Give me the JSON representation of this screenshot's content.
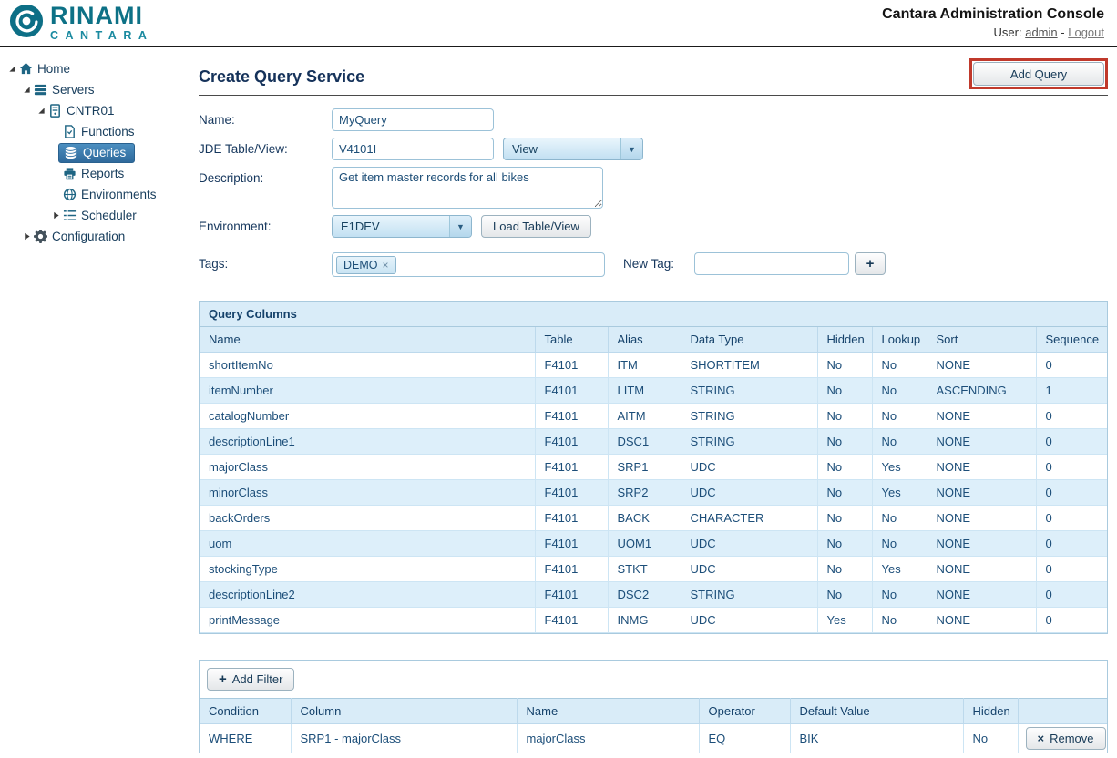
{
  "icons": {
    "close": "×",
    "plus": "+",
    "dropdown_arrow": "▼"
  },
  "header": {
    "brand": "RINAMI",
    "sub_brand": "CANTARA",
    "app_title": "Cantara Administration Console",
    "user_label": "User:",
    "user_name": "admin",
    "separator": "-",
    "logout_label": "Logout"
  },
  "sidebar": {
    "items": [
      {
        "label": "Home",
        "selected": false
      },
      {
        "label": "Servers",
        "selected": false
      },
      {
        "label": "CNTR01",
        "selected": false
      },
      {
        "label": "Functions",
        "selected": false
      },
      {
        "label": "Queries",
        "selected": true
      },
      {
        "label": "Reports",
        "selected": false
      },
      {
        "label": "Environments",
        "selected": false
      },
      {
        "label": "Scheduler",
        "selected": false
      },
      {
        "label": "Configuration",
        "selected": false
      }
    ]
  },
  "main": {
    "title": "Create Query Service",
    "add_query_label": "Add Query"
  },
  "form": {
    "name": {
      "label": "Name:",
      "value": "MyQuery"
    },
    "jde_table_view": {
      "label": "JDE Table/View:",
      "value": "V4101I",
      "type_selected": "View"
    },
    "description": {
      "label": "Description:",
      "value": "Get item master records for all bikes"
    },
    "environment": {
      "label": "Environment:",
      "selected": "E1DEV",
      "load_button_label": "Load Table/View"
    },
    "tags": {
      "label": "Tags:",
      "values": [
        "DEMO"
      ],
      "new_tag_label": "New Tag:"
    }
  },
  "query_columns": {
    "title": "Query Columns",
    "headers": [
      "Name",
      "Table",
      "Alias",
      "Data Type",
      "Hidden",
      "Lookup",
      "Sort",
      "Sequence"
    ],
    "rows": [
      [
        "shortItemNo",
        "F4101",
        "ITM",
        "SHORTITEM",
        "No",
        "No",
        "NONE",
        "0"
      ],
      [
        "itemNumber",
        "F4101",
        "LITM",
        "STRING",
        "No",
        "No",
        "ASCENDING",
        "1"
      ],
      [
        "catalogNumber",
        "F4101",
        "AITM",
        "STRING",
        "No",
        "No",
        "NONE",
        "0"
      ],
      [
        "descriptionLine1",
        "F4101",
        "DSC1",
        "STRING",
        "No",
        "No",
        "NONE",
        "0"
      ],
      [
        "majorClass",
        "F4101",
        "SRP1",
        "UDC",
        "No",
        "Yes",
        "NONE",
        "0"
      ],
      [
        "minorClass",
        "F4101",
        "SRP2",
        "UDC",
        "No",
        "Yes",
        "NONE",
        "0"
      ],
      [
        "backOrders",
        "F4101",
        "BACK",
        "CHARACTER",
        "No",
        "No",
        "NONE",
        "0"
      ],
      [
        "uom",
        "F4101",
        "UOM1",
        "UDC",
        "No",
        "No",
        "NONE",
        "0"
      ],
      [
        "stockingType",
        "F4101",
        "STKT",
        "UDC",
        "No",
        "Yes",
        "NONE",
        "0"
      ],
      [
        "descriptionLine2",
        "F4101",
        "DSC2",
        "STRING",
        "No",
        "No",
        "NONE",
        "0"
      ],
      [
        "printMessage",
        "F4101",
        "INMG",
        "UDC",
        "Yes",
        "No",
        "NONE",
        "0"
      ]
    ]
  },
  "filters": {
    "add_filter_label": "Add Filter",
    "headers": [
      "Condition",
      "Column",
      "Name",
      "Operator",
      "Default Value",
      "Hidden",
      ""
    ],
    "rows": [
      [
        "WHERE",
        "SRP1 - majorClass",
        "majorClass",
        "EQ",
        "BIK",
        "No"
      ]
    ],
    "remove_label": "Remove"
  }
}
